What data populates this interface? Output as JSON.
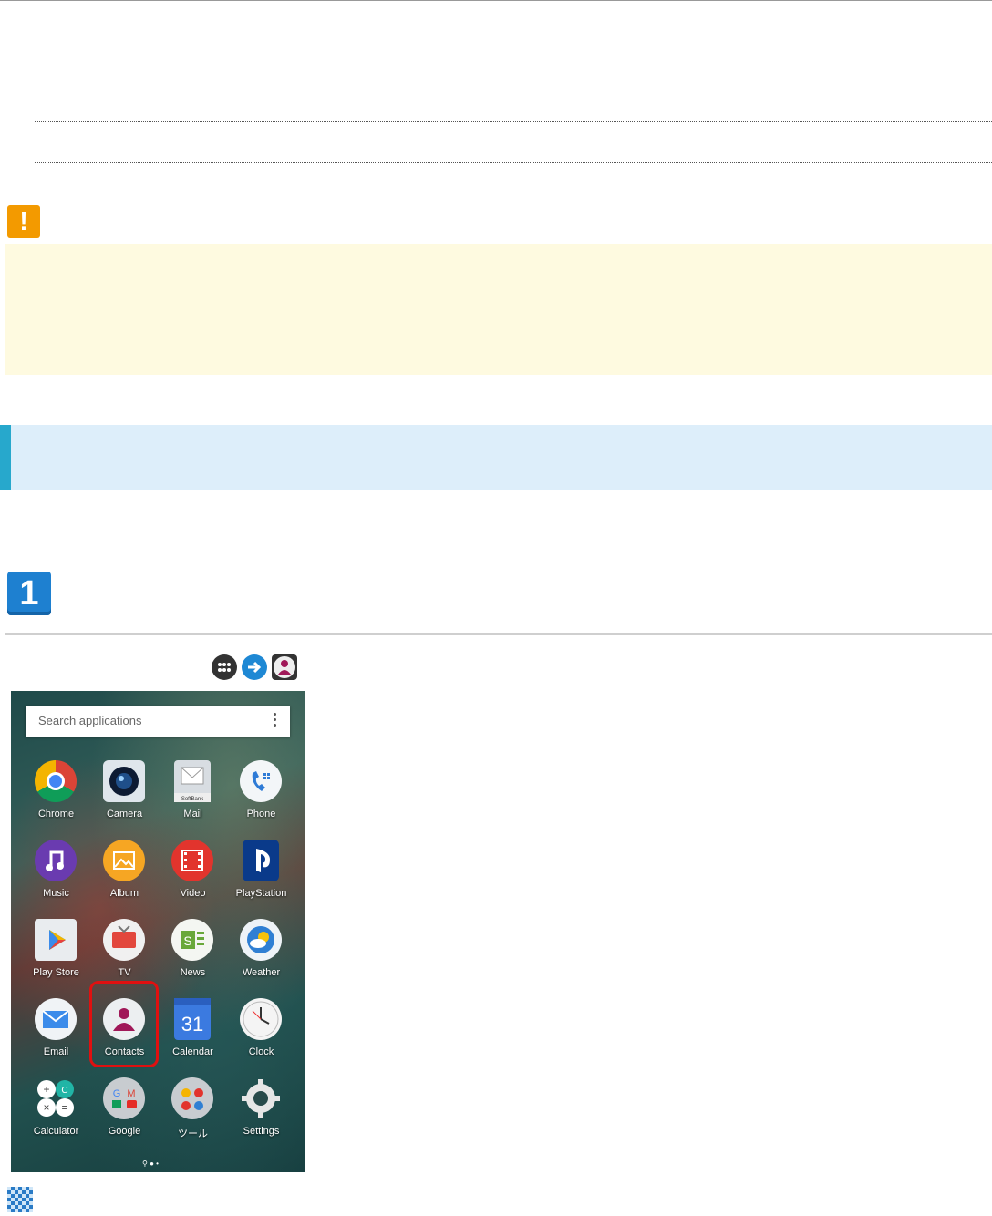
{
  "step": {
    "number": "1"
  },
  "warning_icon": {
    "glyph": "!"
  },
  "operation_icons": [
    "apps-grid-icon",
    "arrow-right-icon",
    "contacts-icon"
  ],
  "phone_screen": {
    "search": {
      "placeholder": "Search applications"
    },
    "apps": [
      {
        "label": "Chrome"
      },
      {
        "label": "Camera"
      },
      {
        "label": "Mail"
      },
      {
        "label": "Phone"
      },
      {
        "label": "Music"
      },
      {
        "label": "Album"
      },
      {
        "label": "Video"
      },
      {
        "label": "PlayStation"
      },
      {
        "label": "Play Store"
      },
      {
        "label": "TV"
      },
      {
        "label": "News"
      },
      {
        "label": "Weather"
      },
      {
        "label": "Email"
      },
      {
        "label": "Contacts"
      },
      {
        "label": "Calendar"
      },
      {
        "label": "Clock"
      },
      {
        "label": "Calculator"
      },
      {
        "label": "Google"
      },
      {
        "label": "ツール"
      },
      {
        "label": "Settings"
      }
    ],
    "mail_badge": "SoftBank",
    "calendar_day": "31",
    "highlighted_app": "Contacts",
    "page_indicator": "⚲ ● •"
  },
  "colors": {
    "warning": "#f39a00",
    "caution_bg": "#fefae0",
    "section_bg": "#ddeefa",
    "section_accent": "#27a8cc",
    "step_badge": "#1e80d0",
    "highlight": "#e01010"
  }
}
